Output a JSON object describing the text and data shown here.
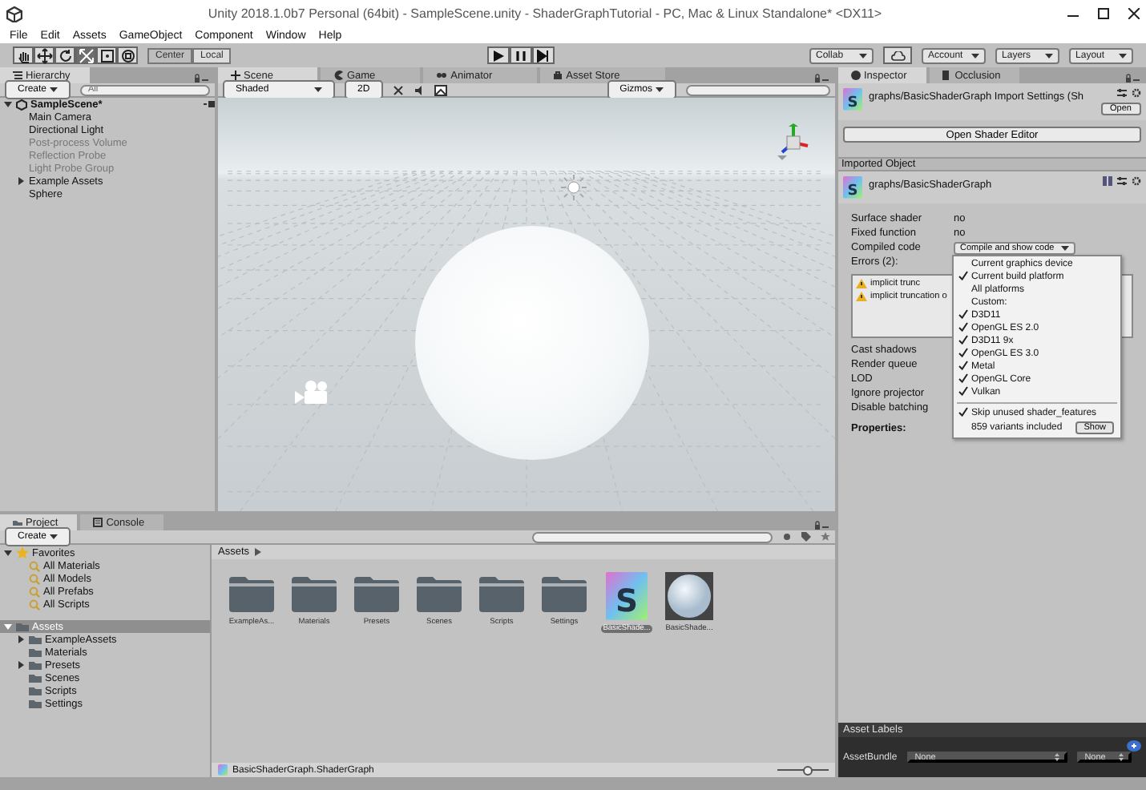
{
  "window": {
    "title": "Unity 2018.1.0b7 Personal (64bit) - SampleScene.unity - ShaderGraphTutorial - PC, Mac & Linux Standalone* <DX11>"
  },
  "menu_bar": [
    "File",
    "Edit",
    "Assets",
    "GameObject",
    "Component",
    "Window",
    "Help"
  ],
  "toolbar": {
    "tools": [
      {
        "kind": "hand",
        "selected": false
      },
      {
        "kind": "move",
        "selected": false
      },
      {
        "kind": "rotate",
        "selected": false
      },
      {
        "kind": "scale",
        "selected": true
      },
      {
        "kind": "rect",
        "selected": false
      },
      {
        "kind": "transform",
        "selected": false
      }
    ],
    "pivot": [
      {
        "label": "Center",
        "selected": true
      },
      {
        "label": "Local",
        "selected": false
      }
    ],
    "menus": [
      "Collab",
      "Account",
      "Layers",
      "Layout"
    ]
  },
  "hierarchy": {
    "tab": "Hierarchy",
    "create": "Create",
    "search": {
      "placeholder": "All"
    },
    "items": [
      {
        "label": "SampleScene*",
        "expanded": true,
        "disabled": false,
        "children": [
          {
            "label": "Main Camera",
            "disabled": false
          },
          {
            "label": "Directional Light",
            "disabled": false
          },
          {
            "label": "Post-process Volume",
            "disabled": true
          },
          {
            "label": "Reflection Probe",
            "disabled": true
          },
          {
            "label": "Light Probe Group",
            "disabled": true
          },
          {
            "label": "Example Assets",
            "expanded": false,
            "disabled": false
          },
          {
            "label": "Sphere",
            "disabled": false
          }
        ]
      }
    ]
  },
  "scene": {
    "tabs": [
      {
        "label": "Scene",
        "selected": true
      },
      {
        "label": "Game",
        "selected": false
      },
      {
        "label": "Animator",
        "selected": false
      },
      {
        "label": "Asset Store",
        "selected": false
      }
    ],
    "shading": "Shaded",
    "mode_2d": "2D",
    "gizmos": "Gizmos"
  },
  "inspector": {
    "tabs": [
      {
        "label": "Inspector",
        "selected": true
      },
      {
        "label": "Occlusion",
        "selected": false
      }
    ],
    "header_icon": "S",
    "header": "graphs/BasicShaderGraph Import Settings (Sh",
    "open_button": "Open",
    "editor_button": "Open Shader Editor",
    "section": "Imported Object",
    "object_icon": "S",
    "object": "graphs/BasicShaderGraph",
    "fields": [
      {
        "label": "Surface shader",
        "value": "no"
      },
      {
        "label": "Fixed function",
        "value": "no"
      }
    ],
    "compiled": {
      "label": "Compiled code",
      "value": "Compile and show code"
    },
    "errors": {
      "label": "Errors (2):",
      "items": [
        "implicit trunc",
        "implicit truncation o"
      ]
    },
    "more_fields": [
      "Cast shadows",
      "Render queue",
      "LOD",
      "Ignore projector",
      "Disable batching"
    ],
    "properties": "Properties:",
    "dropdown": {
      "items": [
        {
          "label": "Current graphics device",
          "checked": false
        },
        {
          "label": "Current build platform",
          "checked": true
        },
        {
          "label": "All platforms",
          "checked": false
        },
        {
          "label": "Custom:",
          "checked": false
        },
        {
          "label": "D3D11",
          "checked": true
        },
        {
          "label": "OpenGL ES 2.0",
          "checked": true
        },
        {
          "label": "D3D11 9x",
          "checked": true
        },
        {
          "label": "OpenGL ES 3.0",
          "checked": true
        },
        {
          "label": "Metal",
          "checked": true
        },
        {
          "label": "OpenGL Core",
          "checked": true
        },
        {
          "label": "Vulkan",
          "checked": true
        }
      ],
      "skip": {
        "label": "Skip unused shader_features",
        "checked": true
      },
      "variants": "859 variants included",
      "show": "Show"
    },
    "asset_labels": {
      "title": "Asset Labels",
      "bundle_label": "AssetBundle",
      "bundle": "None",
      "variant": "None"
    }
  },
  "project": {
    "tabs": [
      {
        "label": "Project",
        "selected": true
      },
      {
        "label": "Console",
        "selected": false
      }
    ],
    "create": "Create",
    "tree": [
      {
        "label": "Favorites",
        "kind": "favorites",
        "expanded": true,
        "children": [
          {
            "label": "All Materials",
            "kind": "search"
          },
          {
            "label": "All Models",
            "kind": "search"
          },
          {
            "label": "All Prefabs",
            "kind": "search"
          },
          {
            "label": "All Scripts",
            "kind": "search"
          }
        ]
      },
      {
        "label": "Assets",
        "kind": "folder",
        "expanded": true,
        "selected": true,
        "children": [
          {
            "label": "ExampleAssets",
            "kind": "folder",
            "expanded": false,
            "selected": false
          },
          {
            "label": "Materials",
            "kind": "folder",
            "selected": false
          },
          {
            "label": "Presets",
            "kind": "folder",
            "expanded": false,
            "selected": false
          },
          {
            "label": "Scenes",
            "kind": "folder",
            "selected": false
          },
          {
            "label": "Scripts",
            "kind": "folder",
            "selected": false
          },
          {
            "label": "Settings",
            "kind": "folder",
            "selected": false
          }
        ]
      }
    ],
    "breadcrumb": "Assets",
    "assets": [
      {
        "label": "ExampleAs...",
        "kind": "folder",
        "selected": false
      },
      {
        "label": "Materials",
        "kind": "folder",
        "selected": false
      },
      {
        "label": "Presets",
        "kind": "folder",
        "selected": false
      },
      {
        "label": "Scenes",
        "kind": "folder",
        "selected": false
      },
      {
        "label": "Scripts",
        "kind": "folder",
        "selected": false
      },
      {
        "label": "Settings",
        "kind": "folder",
        "selected": false
      },
      {
        "label": "BasicShade...",
        "kind": "shader",
        "selected": true,
        "icon_text": "S"
      },
      {
        "label": "BasicShade...",
        "kind": "material",
        "selected": false
      }
    ],
    "footer": "BasicShaderGraph.ShaderGraph",
    "zoom": {
      "level": 0.6
    }
  }
}
